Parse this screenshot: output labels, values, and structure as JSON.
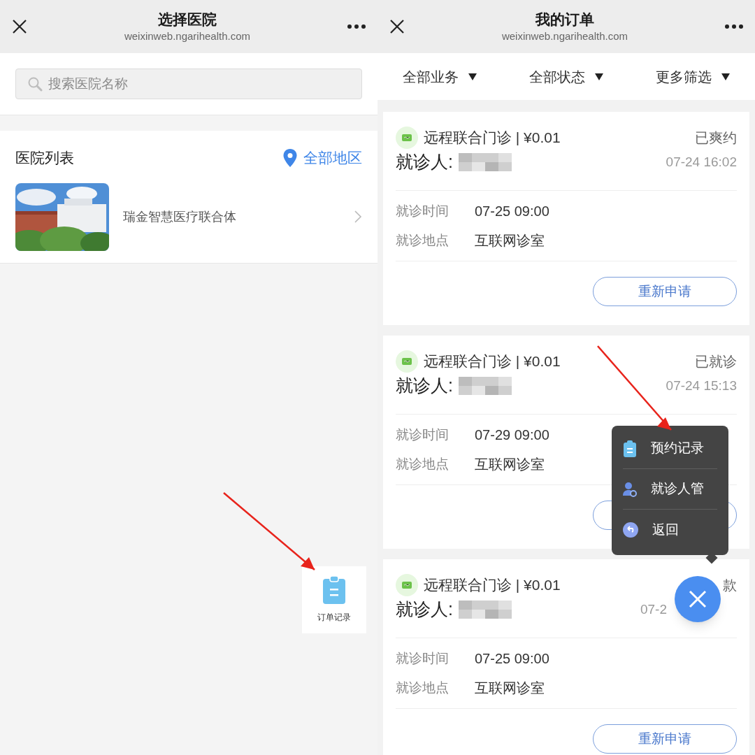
{
  "left": {
    "nav": {
      "title": "选择医院",
      "url": "weixinweb.ngarihealth.com"
    },
    "search": {
      "placeholder": "搜索医院名称"
    },
    "section": {
      "title": "医院列表",
      "region": "全部地区"
    },
    "hospitals": [
      {
        "name": "瑞金智慧医疗联合体"
      }
    ],
    "float_button": {
      "label": "订单记录"
    }
  },
  "right": {
    "nav": {
      "title": "我的订单",
      "url": "weixinweb.ngarihealth.com"
    },
    "filters": [
      {
        "label": "全部业务"
      },
      {
        "label": "全部状态"
      },
      {
        "label": "更多筛选"
      }
    ],
    "orders": [
      {
        "service": "远程联合门诊 | ¥0.01",
        "status": "已爽约",
        "patient": "就诊人:",
        "created": "07-24 16:02",
        "fields": [
          {
            "label": "就诊时间",
            "value": "07-25 09:00"
          },
          {
            "label": "就诊地点",
            "value": "互联网诊室"
          }
        ],
        "action": "重新申请"
      },
      {
        "service": "远程联合门诊 | ¥0.01",
        "status": "已就诊",
        "patient": "就诊人:",
        "created": "07-24 15:13",
        "fields": [
          {
            "label": "就诊时间",
            "value": "07-29 09:00"
          },
          {
            "label": "就诊地点",
            "value": "互联网诊室"
          }
        ]
      },
      {
        "service": "远程联合门诊 | ¥0.01",
        "status": "款",
        "patient": "就诊人:",
        "created": "07-2",
        "fields": [
          {
            "label": "就诊时间",
            "value": "07-25 09:00"
          },
          {
            "label": "就诊地点",
            "value": "互联网诊室"
          }
        ],
        "action": "重新申请"
      }
    ],
    "menu": {
      "items": [
        {
          "label": "预约记录",
          "kind": "records"
        },
        {
          "label": "就诊人管",
          "kind": "patients"
        },
        {
          "label": "返回",
          "kind": "back"
        }
      ]
    }
  }
}
